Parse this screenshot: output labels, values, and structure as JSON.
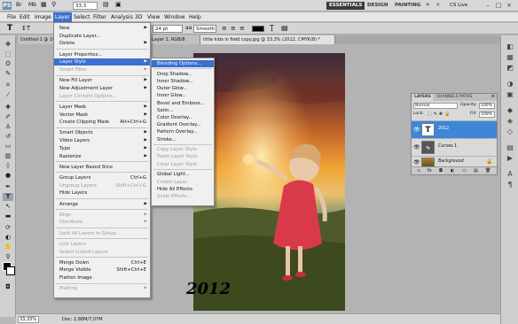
{
  "app": {
    "logo": "PS",
    "zoom_value": "33,3",
    "workspaces": [
      "ESSENTIALS",
      "DESIGN",
      "PAINTING"
    ],
    "cs_live": "CS Live"
  },
  "menubar": [
    "File",
    "Edit",
    "Image",
    "Layer",
    "Select",
    "Filter",
    "Analysis",
    "3D",
    "View",
    "Window",
    "Help"
  ],
  "options": {
    "font_size": "24 pt",
    "antialias": "Smooth"
  },
  "tabs": [
    "Untitled-1 @ 100%",
    "Layer 1, RGB/8",
    "little kids in field copy.jpg @ 33,3% (2012, CMYK/8) *"
  ],
  "layer_menu": [
    {
      "label": "New",
      "sub": true
    },
    {
      "label": "Duplicate Layer...",
      "sub": false
    },
    {
      "label": "Delete",
      "sub": true
    },
    {
      "sep": true
    },
    {
      "label": "Layer Properties...",
      "sub": false
    },
    {
      "label": "Layer Style",
      "sub": true,
      "hl": true
    },
    {
      "label": "Smart Filter",
      "sub": true,
      "disabled": true
    },
    {
      "sep": true
    },
    {
      "label": "New Fill Layer",
      "sub": true
    },
    {
      "label": "New Adjustment Layer",
      "sub": true
    },
    {
      "label": "Layer Content Options...",
      "disabled": true
    },
    {
      "sep": true
    },
    {
      "label": "Layer Mask",
      "sub": true
    },
    {
      "label": "Vector Mask",
      "sub": true
    },
    {
      "label": "Create Clipping Mask",
      "shortcut": "Alt+Ctrl+G"
    },
    {
      "sep": true
    },
    {
      "label": "Smart Objects",
      "sub": true
    },
    {
      "label": "Video Layers",
      "sub": true
    },
    {
      "label": "Type",
      "sub": true
    },
    {
      "label": "Rasterize",
      "sub": true
    },
    {
      "sep": true
    },
    {
      "label": "New Layer Based Slice"
    },
    {
      "sep": true
    },
    {
      "label": "Group Layers",
      "shortcut": "Ctrl+G"
    },
    {
      "label": "Ungroup Layers",
      "shortcut": "Shift+Ctrl+G",
      "disabled": true
    },
    {
      "label": "Hide Layers"
    },
    {
      "sep": true
    },
    {
      "label": "Arrange",
      "sub": true
    },
    {
      "sep": true
    },
    {
      "label": "Align",
      "sub": true,
      "disabled": true
    },
    {
      "label": "Distribute",
      "sub": true,
      "disabled": true
    },
    {
      "sep": true
    },
    {
      "label": "Lock All Layers in Group...",
      "disabled": true
    },
    {
      "sep": true
    },
    {
      "label": "Link Layers",
      "disabled": true
    },
    {
      "label": "Select Linked Layers",
      "disabled": true
    },
    {
      "sep": true
    },
    {
      "label": "Merge Down",
      "shortcut": "Ctrl+E"
    },
    {
      "label": "Merge Visible",
      "shortcut": "Shift+Ctrl+E"
    },
    {
      "label": "Flatten Image"
    },
    {
      "sep": true
    },
    {
      "label": "Matting",
      "sub": true,
      "disabled": true
    }
  ],
  "style_menu": [
    {
      "label": "Blending Options...",
      "hl": true
    },
    {
      "sep": true
    },
    {
      "label": "Drop Shadow..."
    },
    {
      "label": "Inner Shadow..."
    },
    {
      "label": "Outer Glow..."
    },
    {
      "label": "Inner Glow..."
    },
    {
      "label": "Bevel and Emboss..."
    },
    {
      "label": "Satin..."
    },
    {
      "label": "Color Overlay..."
    },
    {
      "label": "Gradient Overlay..."
    },
    {
      "label": "Pattern Overlay..."
    },
    {
      "label": "Stroke..."
    },
    {
      "sep": true
    },
    {
      "label": "Copy Layer Style",
      "disabled": true
    },
    {
      "label": "Paste Layer Style",
      "disabled": true
    },
    {
      "label": "Clear Layer Style",
      "disabled": true
    },
    {
      "sep": true
    },
    {
      "label": "Global Light..."
    },
    {
      "label": "Create Layer",
      "disabled": true
    },
    {
      "label": "Hide All Effects"
    },
    {
      "label": "Scale Effects...",
      "disabled": true
    }
  ],
  "layers_panel": {
    "tabs": [
      "LAYERS",
      "CHANNELS",
      "PATHS"
    ],
    "blend_mode": "Normal",
    "opacity_label": "Opacity:",
    "opacity_value": "100%",
    "lock_label": "Lock:",
    "fill_label": "Fill:",
    "fill_value": "100%",
    "layers": [
      {
        "name": "2012",
        "kind": "type",
        "active": true
      },
      {
        "name": "Curves 1",
        "kind": "adjust"
      },
      {
        "name": "Background",
        "kind": "image",
        "locked": true
      }
    ]
  },
  "canvas_text": "2012",
  "status": {
    "zoom": "33,33%",
    "doc": "Doc: 2,88M/7,07M"
  }
}
